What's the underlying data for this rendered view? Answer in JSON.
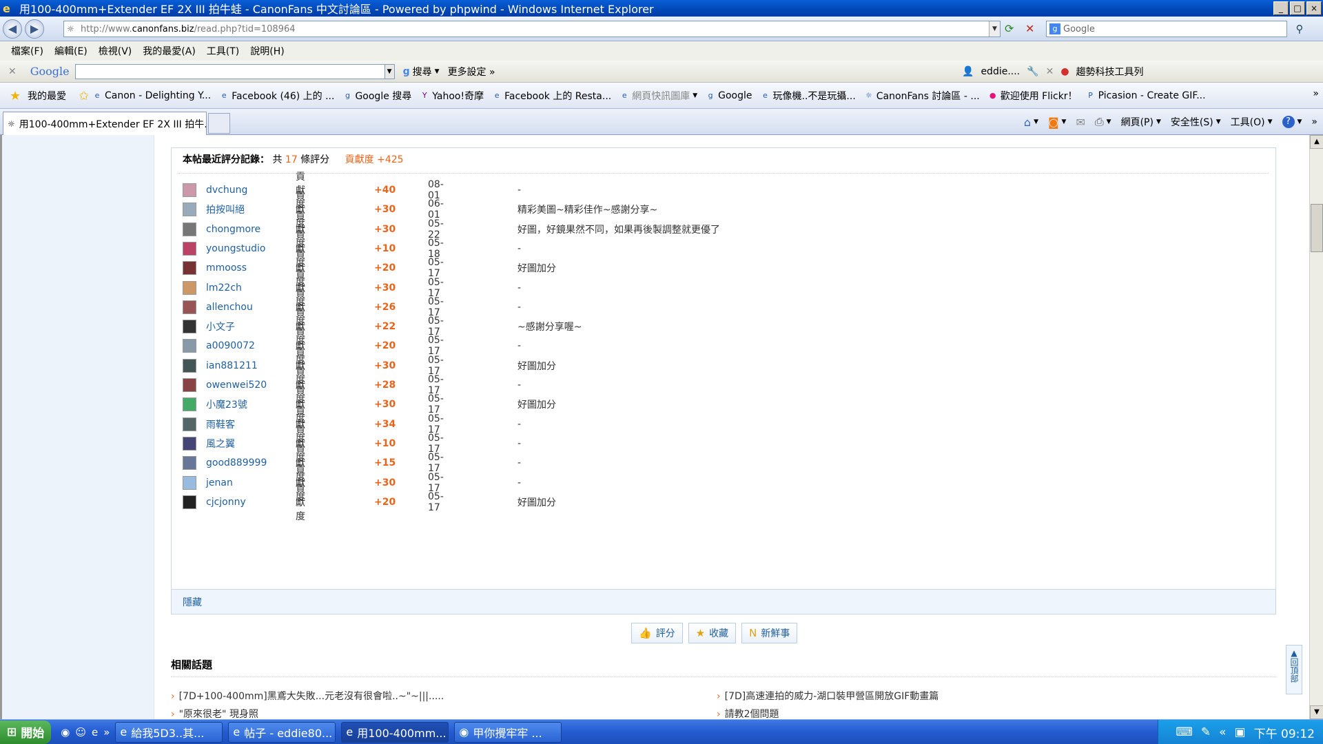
{
  "window": {
    "title": "用100-400mm+Extender EF 2X III 拍牛蛙 - CanonFans 中文討論區 - Powered by phpwind - Windows Internet Explorer",
    "controls": [
      "_",
      "□",
      "×"
    ]
  },
  "address_bar": {
    "url_prefix": "http://www.",
    "url_domain": "canonfans.biz",
    "url_path": "/read.php?tid=108964",
    "search_placeholder": "Google"
  },
  "menu": [
    "檔案(F)",
    "編輯(E)",
    "檢視(V)",
    "我的最愛(A)",
    "工具(T)",
    "說明(H)"
  ],
  "google_toolbar": {
    "logo": "Google",
    "search_label": "搜尋",
    "more_settings": "更多設定 »",
    "user": "eddie....",
    "trend_tools": "趨勢科技工具列"
  },
  "favorites_bar": {
    "main_label": "我的最愛",
    "links": [
      "Canon - Delighting Y...",
      "Facebook (46) 上的 ...",
      "Google 搜尋",
      "Yahoo!奇摩",
      "Facebook 上的 Resta...",
      "網頁快訊圖庫",
      "Google",
      "玩像機..不是玩攝...",
      "CanonFans 討論區 - ...",
      "歡迎使用 Flickr！",
      "Picasion - Create GIF..."
    ]
  },
  "tab": {
    "title": "用100-400mm+Extender EF 2X III 拍牛..."
  },
  "command_bar": {
    "page": "網頁(P)",
    "safety": "安全性(S)",
    "tools": "工具(O)"
  },
  "ratings": {
    "header_label": "本帖最近評分記錄：",
    "header_count_prefix": "共",
    "header_count": "17",
    "header_count_suffix": "條評分",
    "header_total": "貢獻度 +425",
    "rows": [
      {
        "user": "dvchung",
        "type": "貢獻度",
        "points": "+40",
        "date": "08-01",
        "comment": "-"
      },
      {
        "user": "拍按叫絕",
        "type": "貢獻度",
        "points": "+30",
        "date": "06-01",
        "comment": "精彩美圖~精彩佳作~感謝分享~"
      },
      {
        "user": "chongmore",
        "type": "貢獻度",
        "points": "+30",
        "date": "05-22",
        "comment": "好圖，好鏡果然不同，如果再後製調整就更優了"
      },
      {
        "user": "youngstudio",
        "type": "貢獻度",
        "points": "+10",
        "date": "05-18",
        "comment": "-"
      },
      {
        "user": "mmooss",
        "type": "貢獻度",
        "points": "+20",
        "date": "05-17",
        "comment": "好圖加分"
      },
      {
        "user": "lm22ch",
        "type": "貢獻度",
        "points": "+30",
        "date": "05-17",
        "comment": "-"
      },
      {
        "user": "allenchou",
        "type": "貢獻度",
        "points": "+26",
        "date": "05-17",
        "comment": "-"
      },
      {
        "user": "小文子",
        "type": "貢獻度",
        "points": "+22",
        "date": "05-17",
        "comment": "~感謝分享喔~"
      },
      {
        "user": "a0090072",
        "type": "貢獻度",
        "points": "+20",
        "date": "05-17",
        "comment": "-"
      },
      {
        "user": "ian881211",
        "type": "貢獻度",
        "points": "+30",
        "date": "05-17",
        "comment": "好圖加分"
      },
      {
        "user": "owenwei520",
        "type": "貢獻度",
        "points": "+28",
        "date": "05-17",
        "comment": "-"
      },
      {
        "user": "小魔23號",
        "type": "貢獻度",
        "points": "+30",
        "date": "05-17",
        "comment": "好圖加分"
      },
      {
        "user": "雨鞋客",
        "type": "貢獻度",
        "points": "+34",
        "date": "05-17",
        "comment": "-"
      },
      {
        "user": "風之翼",
        "type": "貢獻度",
        "points": "+10",
        "date": "05-17",
        "comment": "-"
      },
      {
        "user": "good889999",
        "type": "貢獻度",
        "points": "+15",
        "date": "05-17",
        "comment": "-"
      },
      {
        "user": "jenan",
        "type": "貢獻度",
        "points": "+30",
        "date": "05-17",
        "comment": "-"
      },
      {
        "user": "cjcjonny",
        "type": "貢獻度",
        "points": "+20",
        "date": "05-17",
        "comment": "好圖加分"
      }
    ],
    "hide_label": "隱藏"
  },
  "actions": {
    "rate": "評分",
    "favorite": "收藏",
    "news": "新鮮事"
  },
  "related": {
    "title": "相關話題",
    "items": [
      "[7D+100-400mm]黑鳶大失敗...元老沒有很會啦..~\"~|||.....",
      "[7D]高速連拍的威力-湖口裝甲營區開放GIF動畫篇",
      "\"原來很老\" 現身照",
      "請教2個問題"
    ]
  },
  "back_to_top": "回頂部",
  "taskbar": {
    "start": "開始",
    "tasks": [
      "給我5D3..其...",
      "帖子 - eddie80...",
      "用100-400mm...",
      "甲你攪牢牢 ..."
    ],
    "clock": "下午 09:12"
  },
  "colors": {
    "accent_orange": "#e8641b",
    "link_blue": "#1f5fa0",
    "panel_border": "#c9d7e8"
  }
}
